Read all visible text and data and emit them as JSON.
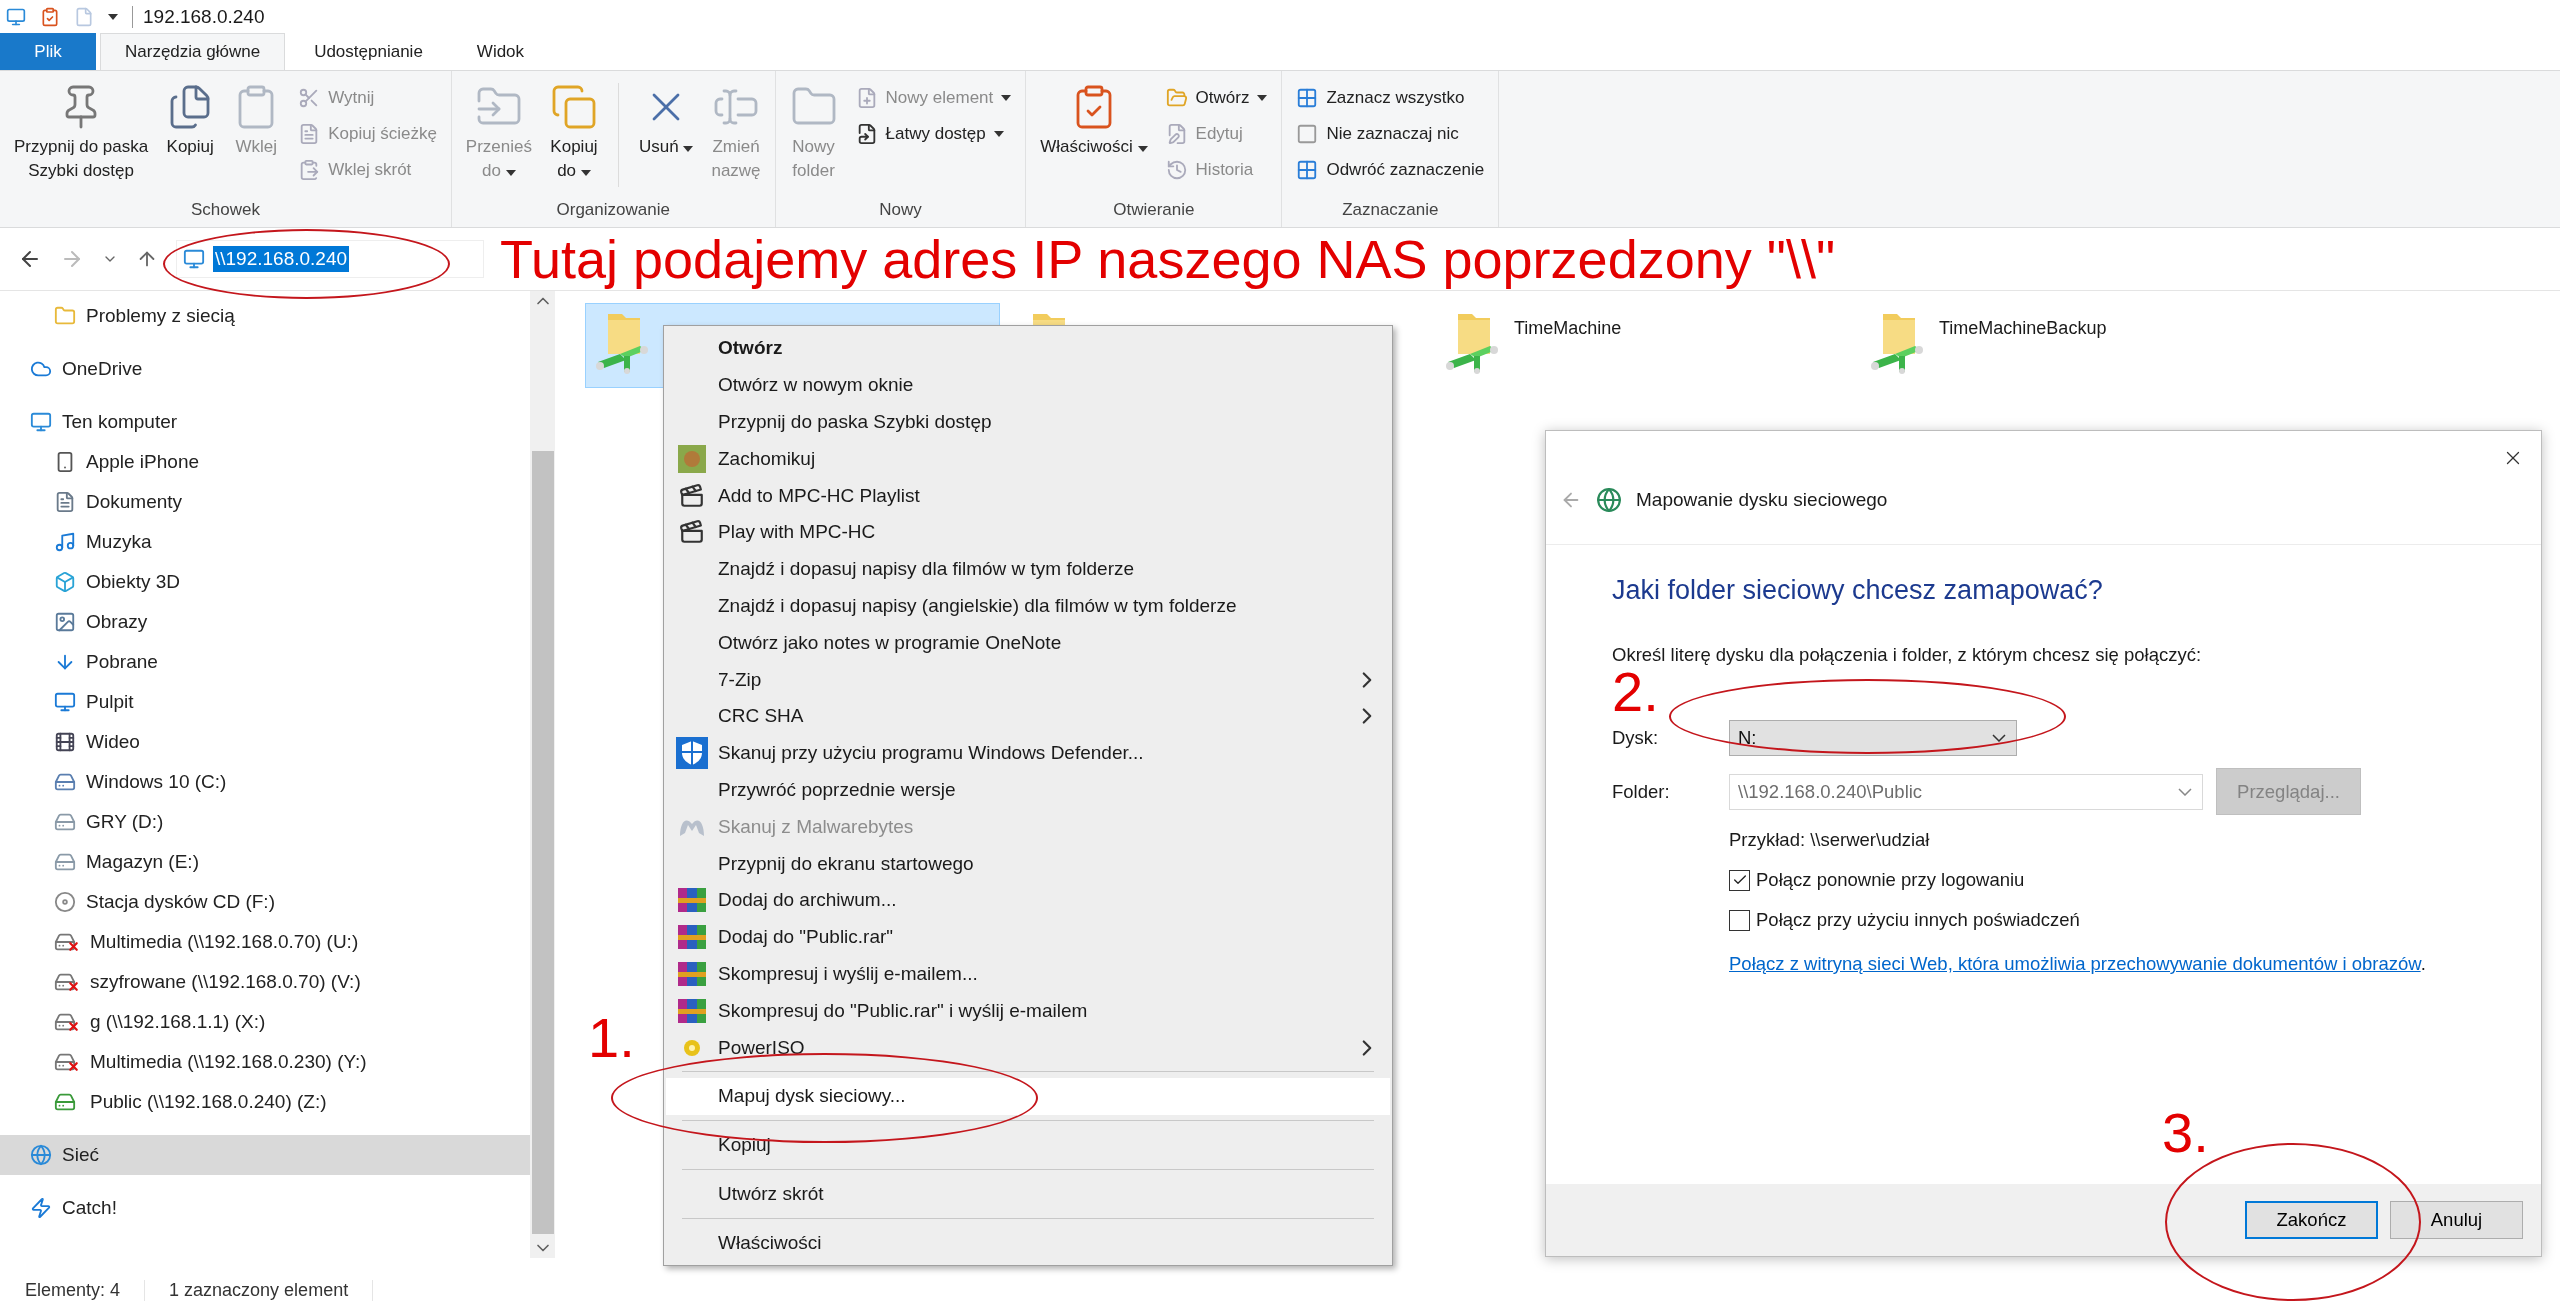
{
  "title_bar": {
    "title": "192.168.0.240"
  },
  "ribbon_tabs": [
    {
      "label": "Plik",
      "kind": "file",
      "selected": false
    },
    {
      "label": "Narzędzia główne",
      "kind": "tab",
      "selected": true
    },
    {
      "label": "Udostępnianie",
      "kind": "tab",
      "selected": false
    },
    {
      "label": "Widok",
      "kind": "tab",
      "selected": false
    }
  ],
  "ribbon_groups": [
    {
      "label": "Schowek",
      "items": [
        {
          "kind": "large",
          "lines": [
            "Przypnij do paska",
            "Szybki dostęp"
          ],
          "disabled": false,
          "dropdown": false
        },
        {
          "kind": "large",
          "lines": [
            "Kopiuj"
          ],
          "disabled": false,
          "dropdown": false
        },
        {
          "kind": "large",
          "lines": [
            "Wklej"
          ],
          "disabled": true,
          "dropdown": false
        },
        {
          "kind": "stack",
          "commands": [
            {
              "label": "Wytnij",
              "disabled": true,
              "dropdown": false
            },
            {
              "label": "Kopiuj ścieżkę",
              "disabled": true,
              "dropdown": false
            },
            {
              "label": "Wklej skrót",
              "disabled": true,
              "dropdown": false
            }
          ]
        }
      ]
    },
    {
      "label": "Organizowanie",
      "items": [
        {
          "kind": "large",
          "lines": [
            "Przenieś",
            "do"
          ],
          "disabled": true,
          "dropdown": true
        },
        {
          "kind": "large",
          "lines": [
            "Kopiuj",
            "do"
          ],
          "disabled": false,
          "dropdown": true
        },
        {
          "kind": "separator"
        },
        {
          "kind": "large",
          "lines": [
            "Usuń"
          ],
          "disabled": false,
          "dropdown": true
        },
        {
          "kind": "large",
          "lines": [
            "Zmień",
            "nazwę"
          ],
          "disabled": true,
          "dropdown": false
        }
      ]
    },
    {
      "label": "Nowy",
      "items": [
        {
          "kind": "large",
          "lines": [
            "Nowy",
            "folder"
          ],
          "disabled": true,
          "dropdown": false
        },
        {
          "kind": "stack",
          "commands": [
            {
              "label": "Nowy element",
              "disabled": true,
              "dropdown": true
            },
            {
              "label": "Łatwy dostęp",
              "disabled": false,
              "dropdown": true
            }
          ]
        }
      ]
    },
    {
      "label": "Otwieranie",
      "items": [
        {
          "kind": "large",
          "lines": [
            "Właściwości"
          ],
          "disabled": false,
          "dropdown": true
        },
        {
          "kind": "stack",
          "commands": [
            {
              "label": "Otwórz",
              "disabled": false,
              "dropdown": true
            },
            {
              "label": "Edytuj",
              "disabled": true,
              "dropdown": false
            },
            {
              "label": "Historia",
              "disabled": true,
              "dropdown": false
            }
          ]
        }
      ]
    },
    {
      "label": "Zaznaczanie",
      "items": [
        {
          "kind": "stack",
          "commands": [
            {
              "label": "Zaznacz wszystko",
              "disabled": false,
              "dropdown": false
            },
            {
              "label": "Nie zaznaczaj nic",
              "disabled": false,
              "dropdown": false
            },
            {
              "label": "Odwróć zaznaczenie",
              "disabled": false,
              "dropdown": false
            }
          ]
        }
      ]
    }
  ],
  "address_bar": {
    "path": "\\\\192.168.0.240"
  },
  "sidebar": {
    "items": [
      {
        "children": [
          {
            "label": "Problemy z siecią",
            "kind": "folder",
            "selected": false
          }
        ]
      },
      {
        "label": "OneDrive",
        "kind": "cloud",
        "selected": false
      },
      {
        "label": "Ten komputer",
        "kind": "computer",
        "selected": false,
        "children": [
          {
            "label": "Apple iPhone",
            "kind": "phone",
            "selected": false
          },
          {
            "label": "Dokumenty",
            "kind": "documents",
            "selected": false
          },
          {
            "label": "Muzyka",
            "kind": "music",
            "selected": false
          },
          {
            "label": "Obiekty 3D",
            "kind": "objects-3d",
            "selected": false
          },
          {
            "label": "Obrazy",
            "kind": "pictures",
            "selected": false
          },
          {
            "label": "Pobrane",
            "kind": "downloads",
            "selected": false
          },
          {
            "label": "Pulpit",
            "kind": "desktop",
            "selected": false
          },
          {
            "label": "Wideo",
            "kind": "video",
            "selected": false
          },
          {
            "label": "Windows 10 (C:)",
            "kind": "system-drive",
            "selected": false
          },
          {
            "label": "GRY (D:)",
            "kind": "drive",
            "selected": false
          },
          {
            "label": "Magazyn (E:)",
            "kind": "drive",
            "selected": false
          },
          {
            "label": "Stacja dysków CD (F:)",
            "kind": "optical-drive",
            "selected": false
          },
          {
            "label": "Multimedia (\\\\192.168.0.70) (U:)",
            "kind": "network-drive",
            "disconnected": true,
            "selected": false
          },
          {
            "label": "szyfrowane (\\\\192.168.0.70) (V:)",
            "kind": "network-drive",
            "disconnected": true,
            "selected": false
          },
          {
            "label": "g (\\\\192.168.1.1) (X:)",
            "kind": "network-drive",
            "disconnected": true,
            "selected": false
          },
          {
            "label": "Multimedia (\\\\192.168.0.230) (Y:)",
            "kind": "network-drive",
            "disconnected": true,
            "selected": false
          },
          {
            "label": "Public (\\\\192.168.0.240) (Z:)",
            "kind": "network-drive",
            "disconnected": false,
            "selected": false
          }
        ]
      },
      {
        "label": "Sieć",
        "kind": "network",
        "selected": true
      },
      {
        "label": "Catch!",
        "kind": "catch",
        "selected": false
      }
    ]
  },
  "folders": [
    {
      "selected": true
    },
    {
      "selected": false
    },
    {
      "name": "TimeMachine",
      "selected": false
    },
    {
      "name": "TimeMachineBackup",
      "selected": false
    }
  ],
  "context_menu": {
    "items": [
      {
        "label": "Otwórz",
        "bold": true,
        "selected": false,
        "disabled": false,
        "submenu": false
      },
      {
        "label": "Otwórz w nowym oknie",
        "bold": false,
        "selected": false,
        "disabled": false,
        "submenu": false
      },
      {
        "label": "Przypnij do paska Szybki dostęp",
        "bold": false,
        "selected": false,
        "disabled": false,
        "submenu": false
      },
      {
        "label": "Zachomikuj",
        "bold": false,
        "selected": false,
        "disabled": false,
        "submenu": false
      },
      {
        "label": "Add to MPC-HC Playlist",
        "bold": false,
        "selected": false,
        "disabled": false,
        "submenu": false
      },
      {
        "label": "Play with MPC-HC",
        "bold": false,
        "selected": false,
        "disabled": false,
        "submenu": false
      },
      {
        "label": "Znajdź i dopasuj napisy dla filmów w tym folderze",
        "bold": false,
        "selected": false,
        "disabled": false,
        "submenu": false
      },
      {
        "label": "Znajdź i dopasuj napisy (angielskie) dla filmów w tym folderze",
        "bold": false,
        "selected": false,
        "disabled": false,
        "submenu": false
      },
      {
        "label": "Otwórz jako notes w programie OneNote",
        "bold": false,
        "selected": false,
        "disabled": false,
        "submenu": false
      },
      {
        "label": "7-Zip",
        "bold": false,
        "selected": false,
        "disabled": false,
        "submenu": true
      },
      {
        "label": "CRC SHA",
        "bold": false,
        "selected": false,
        "disabled": false,
        "submenu": true
      },
      {
        "label": "Skanuj przy użyciu programu Windows Defender...",
        "bold": false,
        "selected": false,
        "disabled": false,
        "submenu": false
      },
      {
        "label": "Przywróć poprzednie wersje",
        "bold": false,
        "selected": false,
        "disabled": false,
        "submenu": false
      },
      {
        "label": "Skanuj z Malwarebytes",
        "bold": false,
        "selected": false,
        "disabled": true,
        "submenu": false
      },
      {
        "label": "Przypnij do ekranu startowego",
        "bold": false,
        "selected": false,
        "disabled": false,
        "submenu": false
      },
      {
        "label": "Dodaj do archiwum...",
        "bold": false,
        "selected": false,
        "disabled": false,
        "submenu": false
      },
      {
        "label": "Dodaj do \"Public.rar\"",
        "bold": false,
        "selected": false,
        "disabled": false,
        "submenu": false
      },
      {
        "label": "Skompresuj i wyślij e-mailem...",
        "bold": false,
        "selected": false,
        "disabled": false,
        "submenu": false
      },
      {
        "label": "Skompresuj do \"Public.rar\" i wyślij e-mailem",
        "bold": false,
        "selected": false,
        "disabled": false,
        "submenu": false
      },
      {
        "label": "PowerISO",
        "bold": false,
        "selected": false,
        "disabled": false,
        "submenu": true
      },
      {
        "kind": "separator"
      },
      {
        "label": "Mapuj dysk sieciowy...",
        "bold": false,
        "selected": true,
        "disabled": false,
        "submenu": false
      },
      {
        "kind": "separator"
      },
      {
        "label": "Kopiuj",
        "bold": false,
        "selected": false,
        "disabled": false,
        "submenu": false
      },
      {
        "kind": "separator"
      },
      {
        "label": "Utwórz skrót",
        "bold": false,
        "selected": false,
        "disabled": false,
        "submenu": false
      },
      {
        "kind": "separator"
      },
      {
        "label": "Właściwości",
        "bold": false,
        "selected": false,
        "disabled": false,
        "submenu": false
      }
    ]
  },
  "dialog": {
    "title": "Mapowanie dysku sieciowego",
    "heading": "Jaki folder sieciowy chcesz zamapować?",
    "instruction": "Określ literę dysku dla połączenia i folder, z którym chcesz się połączyć:",
    "drive_label": "Dysk:",
    "drive_value": "N:",
    "folder_label": "Folder:",
    "folder_field": {
      "value": "\\\\192.168.0.240\\Public",
      "disabled": true
    },
    "browse_button": {
      "label": "Przeglądaj...",
      "disabled": true
    },
    "example": "Przykład: \\\\serwer\\udział",
    "checkboxes": [
      {
        "label": "Połącz ponownie przy logowaniu",
        "checked": true
      },
      {
        "label": "Połącz przy użyciu innych poświadczeń",
        "checked": false
      }
    ],
    "link": {
      "text": "Połącz z witryną sieci Web, która umożliwia przechowywanie dokumentów i obrazów",
      "after": "."
    },
    "buttons": [
      {
        "label": "Zakończ",
        "default": true
      },
      {
        "label": "Anuluj",
        "default": false
      }
    ]
  },
  "annotations": {
    "headline": "Tutaj podajemy adres IP naszego NAS poprzedzony \"\\\\\"",
    "steps": [
      "1.",
      "2.",
      "3."
    ]
  },
  "status_bar": {
    "items": [
      "Elementy: 4",
      "1 zaznaczony element"
    ]
  }
}
